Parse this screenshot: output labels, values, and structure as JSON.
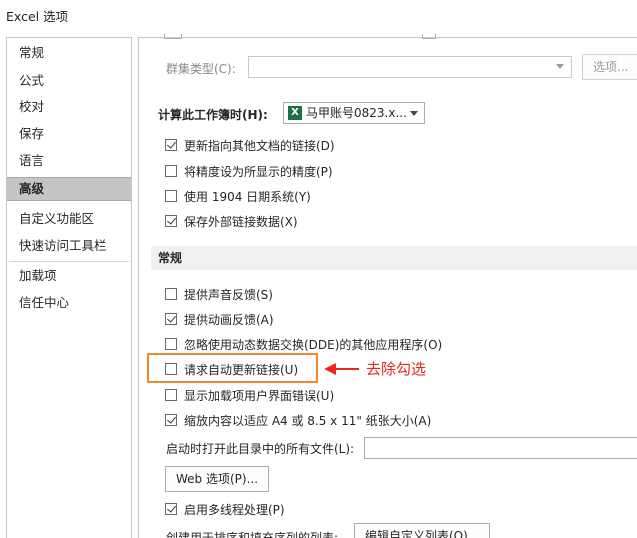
{
  "window": {
    "title": "Excel 选项"
  },
  "sidebar": {
    "items": [
      {
        "label": "常规"
      },
      {
        "label": "公式"
      },
      {
        "label": "校对"
      },
      {
        "label": "保存"
      },
      {
        "label": "语言"
      },
      {
        "label": "高级",
        "selected": true
      },
      {
        "label": "自定义功能区"
      },
      {
        "label": "快速访问工具栏"
      },
      {
        "label": "加载项"
      },
      {
        "label": "信任中心"
      }
    ]
  },
  "cluster_type": {
    "label": "群集类型(C):",
    "value": "",
    "options_button": "选项..."
  },
  "calc_section": {
    "label": "计算此工作簿时(H):",
    "workbook": "马甲账号0823.x...",
    "options": [
      {
        "label": "更新指向其他文档的链接(D)",
        "checked": true
      },
      {
        "label": "将精度设为所显示的精度(P)",
        "checked": false
      },
      {
        "label": "使用 1904 日期系统(Y)",
        "checked": false
      },
      {
        "label": "保存外部链接数据(X)",
        "checked": true
      }
    ]
  },
  "general_section": {
    "title": "常规",
    "options": [
      {
        "label": "提供声音反馈(S)",
        "checked": false
      },
      {
        "label": "提供动画反馈(A)",
        "checked": true
      },
      {
        "label": "忽略使用动态数据交换(DDE)的其他应用程序(O)",
        "checked": false
      },
      {
        "label": "请求自动更新链接(U)",
        "checked": false
      },
      {
        "label": "显示加载项用户界面错误(U)",
        "checked": false
      },
      {
        "label": "缩放内容以适应 A4 或 8.5 x 11\" 纸张大小(A)",
        "checked": true
      }
    ],
    "startup_label": "启动时打开此目录中的所有文件(L):",
    "startup_value": "",
    "web_options_button": "Web 选项(P)...",
    "multithread": {
      "label": "启用多线程处理(P)",
      "checked": true
    },
    "sort_lists_label": "创建用于排序和填充序列的列表:",
    "edit_lists_button": "编辑自定义列表(O)..."
  },
  "annotation": {
    "text": "去除勾选",
    "color": "#e8281e",
    "box_color": "#f0882f"
  },
  "colors": {
    "excel_green": "#1e7145",
    "selected_bg": "#c5c5c5"
  },
  "icons": {
    "excel_file": "excel-file-icon",
    "dropdown": "chevron-down-icon",
    "checkbox_tick": "checkmark-icon"
  }
}
